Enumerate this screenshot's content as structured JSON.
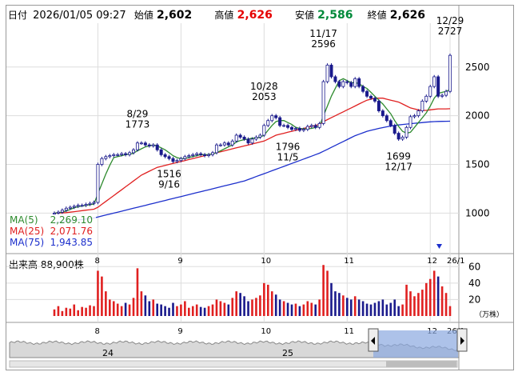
{
  "header": {
    "date_label": "日付",
    "datetime": "2026/01/05 09:27",
    "open_label": "始値",
    "open": "2,602",
    "high_label": "高値",
    "high": "2,626",
    "low_label": "安値",
    "low": "2,586",
    "close_label": "終値",
    "close": "2,626"
  },
  "colors": {
    "high": "#e60000",
    "low": "#008a3a",
    "up_candle": "#ffffff",
    "down_candle": "#1a1a8c",
    "ma5": "#2e8b2e",
    "ma25": "#e02020",
    "ma75": "#1c2fcc",
    "volume_up": "#e02020",
    "volume_down": "#1a1a8c",
    "overview_selection": "#8aa8e0"
  },
  "legend": {
    "ma5_label": "MA(5)",
    "ma5_value": "2,269.10",
    "ma25_label": "MA(25)",
    "ma25_value": "2,071.76",
    "ma75_label": "MA(75)",
    "ma75_value": "1,943.85"
  },
  "annotations": [
    {
      "date": "8/29",
      "value": "1773"
    },
    {
      "date": "9/16",
      "value": "1516"
    },
    {
      "date": "10/28",
      "value": "2053"
    },
    {
      "date": "11/5",
      "value": "1796"
    },
    {
      "date": "11/17",
      "value": "2596"
    },
    {
      "date": "12/17",
      "value": "1699"
    },
    {
      "date": "12/29",
      "value": "2727"
    }
  ],
  "volume_panel": {
    "title": "出来高",
    "value": "88,900株",
    "unit": "（万株）"
  },
  "overview": {
    "labels": [
      "24",
      "25"
    ]
  },
  "chart_data": [
    {
      "type": "candlestick",
      "title": "",
      "x_ticks": [
        "8",
        "9",
        "10",
        "11",
        "12",
        "26/1"
      ],
      "y_ticks": [
        1000,
        1500,
        2000,
        2500
      ],
      "ylim": [
        650,
        2950
      ],
      "grid": true,
      "series": [
        {
          "name": "MA(5)",
          "last": 2269.1
        },
        {
          "name": "MA(25)",
          "last": 2071.76
        },
        {
          "name": "MA(75)",
          "last": 1943.85
        }
      ],
      "close": [
        1000,
        1010,
        1030,
        1050,
        1060,
        1070,
        1080,
        1080,
        1090,
        1100,
        1110,
        1500,
        1560,
        1580,
        1590,
        1600,
        1600,
        1610,
        1600,
        1620,
        1650,
        1720,
        1720,
        1700,
        1690,
        1700,
        1650,
        1600,
        1580,
        1560,
        1530,
        1540,
        1560,
        1580,
        1590,
        1600,
        1610,
        1600,
        1590,
        1600,
        1620,
        1700,
        1700,
        1720,
        1700,
        1740,
        1800,
        1780,
        1760,
        1720,
        1760,
        1780,
        1800,
        1900,
        1950,
        2000,
        1980,
        1900,
        1900,
        1880,
        1860,
        1870,
        1850,
        1860,
        1890,
        1900,
        1880,
        1920,
        2350,
        2520,
        2400,
        2350,
        2300,
        2350,
        2340,
        2300,
        2380,
        2300,
        2250,
        2200,
        2180,
        2150,
        2050,
        2000,
        1950,
        1900,
        1820,
        1760,
        1780,
        1880,
        1990,
        2000,
        2050,
        2150,
        2200,
        2300,
        2400,
        2200,
        2210,
        2250,
        2620
      ],
      "ma5": [
        1000,
        1003,
        1010,
        1022,
        1038,
        1054,
        1066,
        1072,
        1080,
        1086,
        1092,
        1200,
        1300,
        1400,
        1490,
        1570,
        1580,
        1590,
        1600,
        1605,
        1615,
        1640,
        1660,
        1680,
        1690,
        1700,
        1690,
        1670,
        1650,
        1620,
        1590,
        1570,
        1560,
        1560,
        1570,
        1580,
        1590,
        1600,
        1600,
        1600,
        1610,
        1620,
        1640,
        1660,
        1680,
        1700,
        1730,
        1745,
        1755,
        1760,
        1770,
        1770,
        1780,
        1800,
        1850,
        1900,
        1940,
        1950,
        1950,
        1930,
        1910,
        1880,
        1870,
        1865,
        1865,
        1870,
        1880,
        1890,
        2000,
        2100,
        2200,
        2280,
        2360,
        2380,
        2360,
        2340,
        2340,
        2330,
        2300,
        2280,
        2240,
        2200,
        2160,
        2120,
        2070,
        2020,
        1950,
        1890,
        1840,
        1820,
        1830,
        1880,
        1930,
        1980,
        2030,
        2100,
        2180,
        2230,
        2240,
        2250,
        2269
      ],
      "ma25": [
        1000,
        1000,
        1002,
        1005,
        1010,
        1015,
        1020,
        1025,
        1030,
        1035,
        1040,
        1060,
        1090,
        1120,
        1150,
        1180,
        1210,
        1240,
        1270,
        1300,
        1330,
        1360,
        1390,
        1410,
        1430,
        1450,
        1470,
        1480,
        1490,
        1500,
        1510,
        1520,
        1530,
        1540,
        1550,
        1560,
        1570,
        1580,
        1590,
        1600,
        1610,
        1620,
        1630,
        1640,
        1650,
        1660,
        1670,
        1680,
        1690,
        1700,
        1710,
        1720,
        1730,
        1740,
        1760,
        1780,
        1800,
        1810,
        1820,
        1830,
        1840,
        1850,
        1860,
        1870,
        1880,
        1890,
        1900,
        1910,
        1940,
        1960,
        1980,
        2000,
        2020,
        2040,
        2060,
        2080,
        2100,
        2120,
        2140,
        2160,
        2170,
        2180,
        2180,
        2180,
        2170,
        2160,
        2150,
        2140,
        2120,
        2100,
        2080,
        2070,
        2060,
        2055,
        2055,
        2060,
        2065,
        2070,
        2070,
        2070,
        2072
      ],
      "ma75": [
        900,
        905,
        910,
        915,
        920,
        925,
        930,
        935,
        940,
        945,
        950,
        960,
        970,
        980,
        990,
        1000,
        1010,
        1020,
        1030,
        1040,
        1050,
        1060,
        1070,
        1080,
        1090,
        1100,
        1110,
        1120,
        1130,
        1140,
        1150,
        1160,
        1170,
        1180,
        1190,
        1200,
        1210,
        1220,
        1230,
        1240,
        1250,
        1260,
        1270,
        1280,
        1290,
        1300,
        1310,
        1320,
        1330,
        1345,
        1360,
        1375,
        1390,
        1405,
        1420,
        1435,
        1450,
        1465,
        1480,
        1495,
        1510,
        1525,
        1540,
        1555,
        1570,
        1585,
        1600,
        1615,
        1635,
        1655,
        1675,
        1695,
        1715,
        1735,
        1755,
        1775,
        1795,
        1810,
        1825,
        1840,
        1850,
        1860,
        1870,
        1878,
        1886,
        1894,
        1900,
        1905,
        1910,
        1914,
        1918,
        1922,
        1926,
        1930,
        1934,
        1937,
        1940,
        1941,
        1942,
        1943,
        1944
      ],
      "volume": [
        8,
        12,
        6,
        10,
        9,
        14,
        7,
        11,
        10,
        13,
        12,
        55,
        48,
        30,
        20,
        18,
        15,
        12,
        16,
        14,
        22,
        58,
        30,
        25,
        18,
        20,
        15,
        14,
        12,
        10,
        16,
        12,
        14,
        18,
        10,
        12,
        14,
        11,
        10,
        12,
        14,
        20,
        18,
        16,
        14,
        22,
        30,
        28,
        24,
        18,
        20,
        22,
        25,
        40,
        38,
        30,
        26,
        20,
        18,
        16,
        14,
        15,
        12,
        14,
        18,
        16,
        14,
        20,
        62,
        55,
        40,
        30,
        28,
        25,
        22,
        20,
        24,
        20,
        18,
        15,
        14,
        16,
        18,
        20,
        14,
        16,
        20,
        12,
        14,
        38,
        30,
        24,
        28,
        32,
        40,
        45,
        55,
        48,
        36,
        28,
        12
      ]
    }
  ]
}
